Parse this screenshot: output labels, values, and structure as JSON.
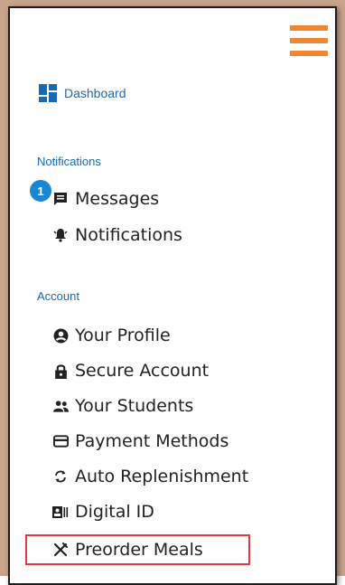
{
  "header": {
    "menu_icon": "hamburger-icon"
  },
  "dashboard": {
    "label": "Dashboard",
    "icon": "dashboard-grid-icon"
  },
  "notifications_section": {
    "title": "Notifications",
    "badge_count": "1",
    "items": [
      {
        "label": "Messages",
        "icon": "message-icon"
      },
      {
        "label": "Notifications",
        "icon": "bell-icon"
      }
    ]
  },
  "account_section": {
    "title": "Account",
    "items": [
      {
        "label": "Your Profile",
        "icon": "user-circle-icon"
      },
      {
        "label": "Secure Account",
        "icon": "lock-icon"
      },
      {
        "label": "Your Students",
        "icon": "group-icon"
      },
      {
        "label": "Payment Methods",
        "icon": "credit-card-icon"
      },
      {
        "label": "Auto Replenishment",
        "icon": "refresh-icon"
      },
      {
        "label": "Digital ID",
        "icon": "id-card-icon"
      },
      {
        "label": "Preorder Meals",
        "icon": "utensils-icon"
      }
    ]
  },
  "colors": {
    "accent_orange": "#ef8633",
    "link_blue": "#1769b8",
    "badge_blue": "#1a86d6",
    "highlight_red": "#e5393f"
  }
}
